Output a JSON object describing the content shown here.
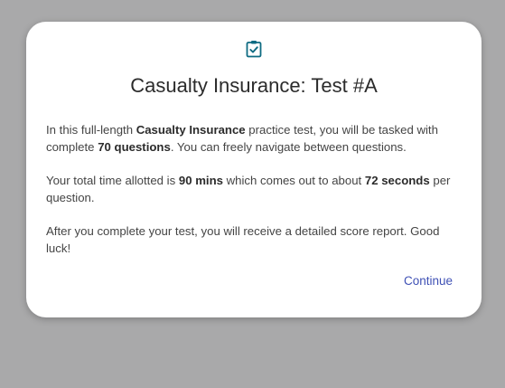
{
  "dialog": {
    "icon": "clipboard-check-icon",
    "title": "Casualty Insurance: Test #A",
    "paragraph1": {
      "t1": "In this full-length ",
      "b1": "Casualty Insurance",
      "t2": " practice test, you will be tasked with complete ",
      "b2": "70 questions",
      "t3": ". You can freely navigate between questions."
    },
    "paragraph2": {
      "t1": "Your total time allotted is ",
      "b1": "90 mins",
      "t2": " which comes out to about ",
      "b2": "72 seconds",
      "t3": " per question."
    },
    "paragraph3": "After you complete your test, you will receive a detailed score report. Good luck!",
    "continue_label": "Continue"
  },
  "colors": {
    "backdrop": "#a9a9aa",
    "icon": "#0e6b82",
    "link": "#3f51b5"
  }
}
